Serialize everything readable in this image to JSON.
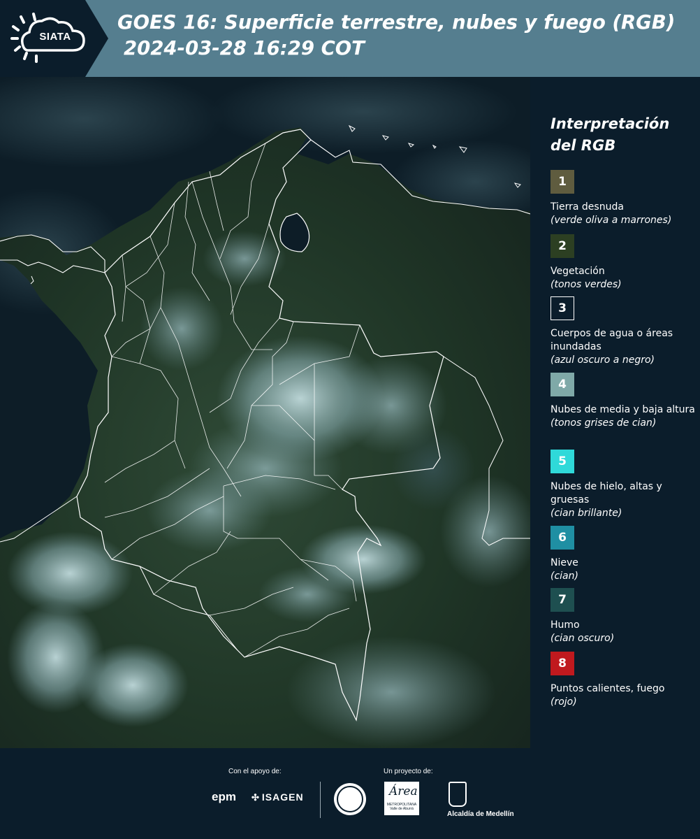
{
  "header": {
    "title_line1": "GOES 16: Superficie terrestre, nubes y fuego (RGB)",
    "title_line2": "2024-03-28 16:29 COT",
    "logo_text": "SIATA",
    "header_color": "#557e8f",
    "dark_color": "#0b1d2b"
  },
  "legend": {
    "title": "Interpretación del RGB",
    "items": [
      {
        "number": "1",
        "label": "Tierra desnuda",
        "note": "(verde oliva a marrones)",
        "color": "#5f5c3f"
      },
      {
        "number": "2",
        "label": "Vegetación",
        "note": "(tonos verdes)",
        "color": "#2c3f22"
      },
      {
        "number": "3",
        "label": "Cuerpos de agua o áreas inundadas",
        "note": "(azul oscuro a negro)",
        "color": "#0b1d2b"
      },
      {
        "number": "4",
        "label": "Nubes de media y baja altura",
        "note": "(tonos grises de cian)",
        "color": "#7fa9a8"
      },
      {
        "number": "5",
        "label": "Nubes de hielo, altas y gruesas",
        "note": "(cian brillante)",
        "color": "#2fd9d9"
      },
      {
        "number": "6",
        "label": "Nieve",
        "note": "(cian)",
        "color": "#1f8fa3"
      },
      {
        "number": "7",
        "label": "Humo",
        "note": "(cian oscuro)",
        "color": "#1e4f50"
      },
      {
        "number": "8",
        "label": "Puntos calientes, fuego",
        "note": "(rojo)",
        "color": "#c0191e"
      }
    ]
  },
  "footer": {
    "support_caption": "Con el apoyo de:",
    "project_caption": "Un proyecto de:",
    "epm": "epm",
    "isagen": "ISAGEN",
    "area_logo_word": "Área",
    "area_logo_sub": "METROPOLITANA Valle de Aburrá",
    "alcaldia": "Alcaldía de Medellín"
  }
}
